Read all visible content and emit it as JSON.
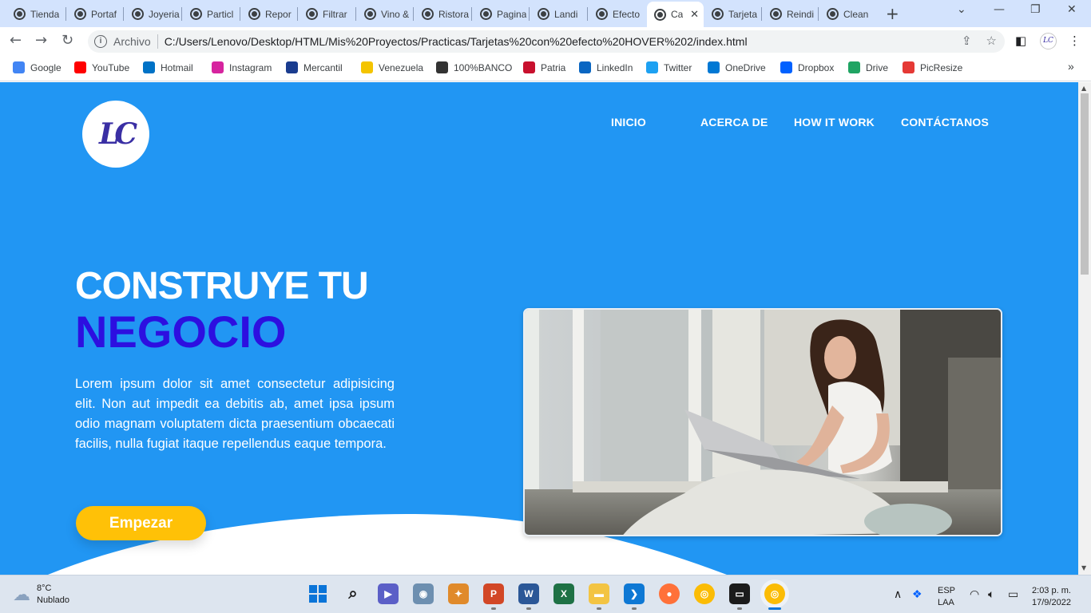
{
  "browser": {
    "tabs": [
      {
        "label": "Tienda",
        "active": false
      },
      {
        "label": "Portaf",
        "active": false
      },
      {
        "label": "Joyeria",
        "active": false
      },
      {
        "label": "Particl",
        "active": false
      },
      {
        "label": "Repor",
        "active": false
      },
      {
        "label": "Filtrar",
        "active": false
      },
      {
        "label": "Vino &",
        "active": false
      },
      {
        "label": "Ristora",
        "active": false
      },
      {
        "label": "Pagina",
        "active": false
      },
      {
        "label": "Landi",
        "active": false
      },
      {
        "label": "Efecto",
        "active": false
      },
      {
        "label": "Ca",
        "active": true
      },
      {
        "label": "Tarjeta",
        "active": false
      },
      {
        "label": "Reindi",
        "active": false
      },
      {
        "label": "Clean",
        "active": false
      }
    ],
    "new_tab_icon": "+",
    "address": {
      "scheme_label": "Archivo",
      "url": "C:/Users/Lenovo/Desktop/HTML/Mis%20Proyectos/Practicas/Tarjetas%20con%20efecto%20HOVER%202/index.html"
    },
    "profile_initials": "LC",
    "bookmarks": [
      {
        "label": "Google",
        "color": "#4285f4"
      },
      {
        "label": "YouTube",
        "color": "#ff0000"
      },
      {
        "label": "Hotmail",
        "color": "#0072c6"
      },
      {
        "label": "Instagram",
        "color": "#d6249f"
      },
      {
        "label": "Mercantil",
        "color": "#1a3c8f"
      },
      {
        "label": "Venezuela",
        "color": "#f4c400"
      },
      {
        "label": "100%BANCO",
        "color": "#333333"
      },
      {
        "label": "Patria",
        "color": "#c8102e"
      },
      {
        "label": "LinkedIn",
        "color": "#0a66c2"
      },
      {
        "label": "Twitter",
        "color": "#1da1f2"
      },
      {
        "label": "OneDrive",
        "color": "#0078d4"
      },
      {
        "label": "Dropbox",
        "color": "#0061ff"
      },
      {
        "label": "Drive",
        "color": "#1fa463"
      },
      {
        "label": "PicResize",
        "color": "#e53935"
      }
    ]
  },
  "page": {
    "logo_text": "LC",
    "nav": [
      "INICIO",
      "ACERCA DE",
      "HOW IT WORK",
      "CONTÁCTANOS"
    ],
    "hero": {
      "title_line1": "CONSTRUYE TU",
      "title_line2": "NEGOCIO",
      "text": "Lorem ipsum dolor sit amet consectetur adipisicing elit. Non aut impedit ea debitis ab, amet ipsa ipsum odio magnam voluptatem dicta praesentium obcaecati facilis, nulla fugiat itaque repellendus eaque tempora.",
      "cta_label": "Empezar"
    },
    "colors": {
      "background": "#2196f3",
      "accent_title": "#2d0fe0",
      "button": "#ffc107"
    }
  },
  "taskbar": {
    "weather_temp": "8°C",
    "weather_desc": "Nublado",
    "language": "ESP",
    "layout": "LAA",
    "time": "2:03 p. m.",
    "date": "17/9/2022"
  }
}
